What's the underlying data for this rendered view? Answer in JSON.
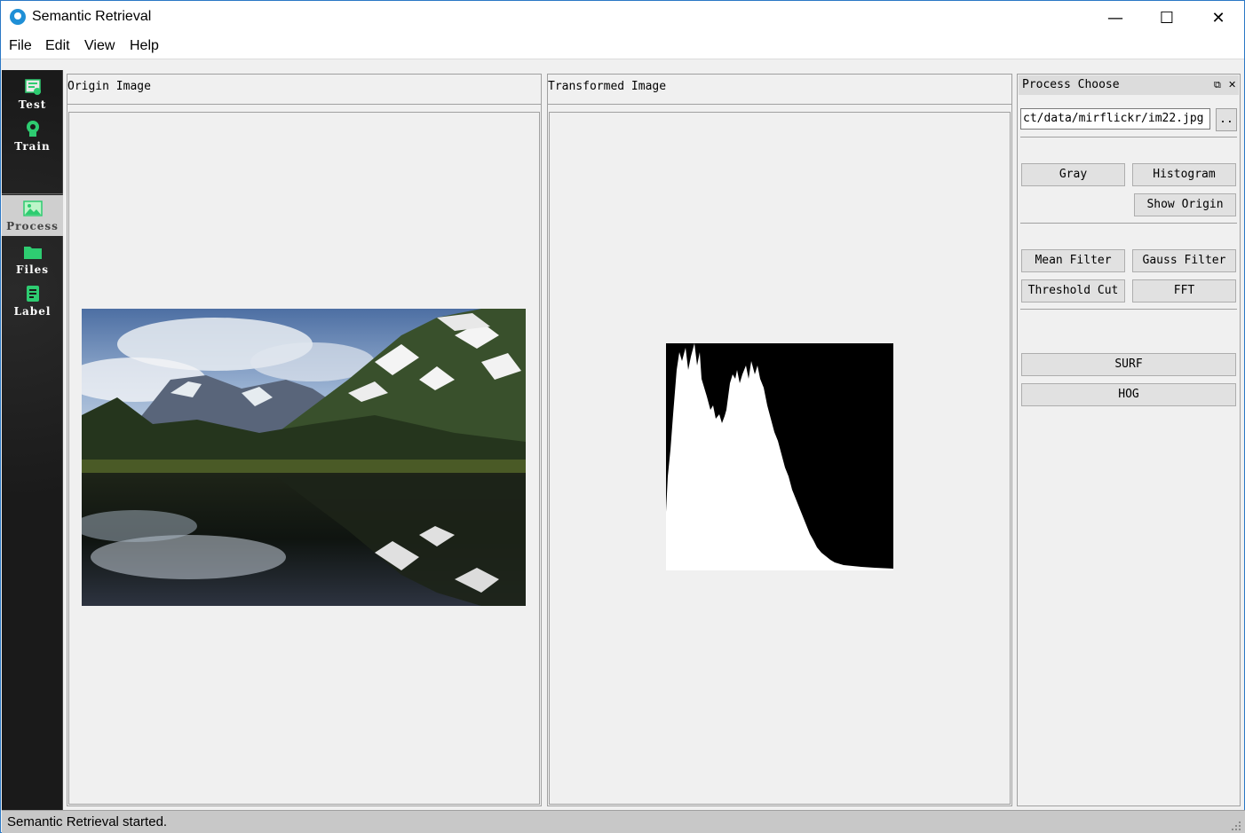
{
  "window": {
    "title": "Semantic Retrieval",
    "minimize_glyph": "—",
    "maximize_glyph": "☐",
    "close_glyph": "✕"
  },
  "menu": [
    "File",
    "Edit",
    "View",
    "Help"
  ],
  "sidebar": {
    "top_items": [
      {
        "label": "Test",
        "icon": "test-icon"
      },
      {
        "label": "Train",
        "icon": "train-icon"
      }
    ],
    "bottom_items": [
      {
        "label": "Process",
        "icon": "image-icon",
        "active": true
      },
      {
        "label": "Files",
        "icon": "folder-icon"
      },
      {
        "label": "Label",
        "icon": "clipboard-icon"
      }
    ]
  },
  "origin_panel": {
    "title": "Origin Image"
  },
  "transformed_panel": {
    "title": "Transformed Image"
  },
  "process_dock": {
    "title": "Process Choose",
    "float_glyph": "⧉",
    "close_glyph": "✕",
    "path_value": "ct/data/mirflickr/im22.jpg",
    "browse_label": "..",
    "buttons": {
      "gray": "Gray",
      "histogram": "Histogram",
      "show_origin": "Show Origin",
      "mean_filter": "Mean Filter",
      "gauss_filter": "Gauss Filter",
      "threshold_cut": "Threshold Cut",
      "fft": "FFT",
      "surf": "SURF",
      "hog": "HOG"
    }
  },
  "status": {
    "text": "Semantic Retrieval started."
  },
  "colors": {
    "accent": "#2b78c5",
    "sidebar_bg": "#1a1a1a",
    "icon_green": "#2ecc71"
  }
}
